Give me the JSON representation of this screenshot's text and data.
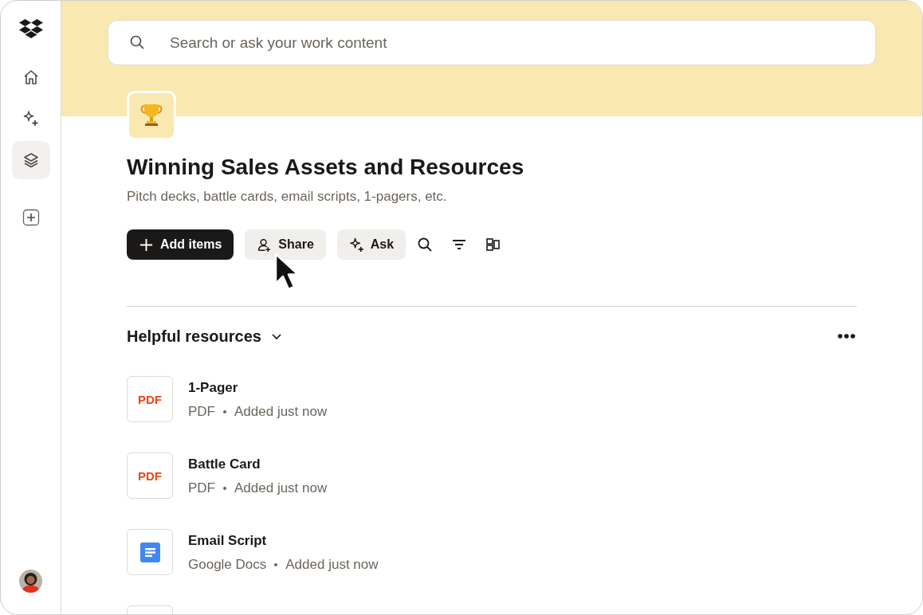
{
  "sidebar": {
    "items": [
      {
        "kind": "home",
        "selected": false
      },
      {
        "kind": "ai",
        "selected": false
      },
      {
        "kind": "stacks",
        "selected": true
      },
      {
        "kind": "add",
        "selected": false
      }
    ]
  },
  "search": {
    "placeholder": "Search or ask your work content"
  },
  "page": {
    "title": "Winning Sales Assets and Resources",
    "subtitle": "Pitch decks, battle cards, email scripts, 1-pagers, etc."
  },
  "toolbar": {
    "buttons": [
      {
        "kind": "add",
        "label": "Add items"
      },
      {
        "kind": "share",
        "label": "Share"
      },
      {
        "kind": "ask",
        "label": "Ask"
      }
    ]
  },
  "section": {
    "title": "Helpful resources",
    "expanded": true,
    "items": [
      {
        "name": "1-Pager",
        "kind": "pdf",
        "badge": "PDF",
        "type": "PDF",
        "added": "Added just now"
      },
      {
        "name": "Battle Card",
        "kind": "pdf",
        "badge": "PDF",
        "type": "PDF",
        "added": "Added just now"
      },
      {
        "name": "Email Script",
        "kind": "doc",
        "type": "Google Docs",
        "added": "Added just now"
      },
      {
        "kind": "blank"
      }
    ]
  }
}
